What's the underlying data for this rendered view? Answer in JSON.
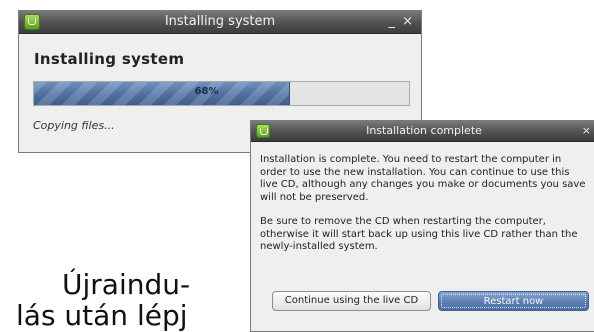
{
  "install_window": {
    "title": "Installing system",
    "minimize_glyph": "_",
    "close_glyph": "×",
    "heading": "Installing system",
    "progress": {
      "value": 0.68,
      "label": "68%"
    },
    "status": "Copying files..."
  },
  "complete_window": {
    "title": "Installation complete",
    "close_glyph": "×",
    "paragraph1": "Installation is complete. You need to restart the computer in order to use the new installation. You can continue to use this live CD, although any changes you make or documents you save will not be preserved.",
    "paragraph2": "Be sure to remove the CD when restarting the computer, otherwise it will start back up using this live CD rather than the newly-installed system.",
    "continue_label": "Continue using the live CD",
    "restart_label": "Restart now"
  },
  "background_text": {
    "line1": "Újraindu-",
    "line2": "lás után lépj"
  },
  "colors": {
    "titlebar": "#545454",
    "progress_fill": "#4e6f9f",
    "restart_button": "#5b7eb2",
    "app_icon": "#5c9e25"
  },
  "icons": {
    "app": "mint-app-icon"
  }
}
